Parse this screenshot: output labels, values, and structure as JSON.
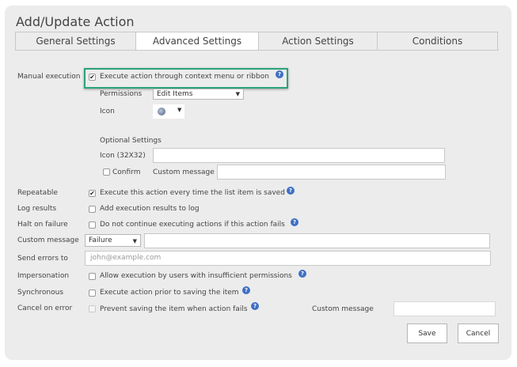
{
  "title": "Add/Update Action",
  "tabs": [
    "General Settings",
    "Advanced Settings",
    "Action Settings",
    "Conditions"
  ],
  "manual_execution": {
    "label": "Manual execution",
    "checkbox_label": "Execute action through context menu or ribbon",
    "permissions_label": "Permissions",
    "permissions_value": "Edit Items",
    "icon_label": "Icon",
    "optional_title": "Optional Settings",
    "icon32_label": "Icon (32X32)",
    "confirm_label": "Confirm",
    "custom_message_label": "Custom message"
  },
  "rows": {
    "repeatable": {
      "label": "Repeatable",
      "text": "Execute this action every time the list item is saved"
    },
    "log_results": {
      "label": "Log results",
      "text": "Add execution results to log"
    },
    "halt_on_failure": {
      "label": "Halt on failure",
      "text": "Do not continue executing actions if this action fails"
    },
    "custom_message": {
      "label": "Custom message",
      "select_value": "Failure"
    },
    "send_errors": {
      "label": "Send errors to",
      "placeholder": "john@example.com"
    },
    "impersonation": {
      "label": "Impersonation",
      "text": "Allow execution by users with insufficient permissions"
    },
    "synchronous": {
      "label": "Synchronous",
      "text": "Execute action prior to saving the item"
    },
    "cancel_on_error": {
      "label": "Cancel on error",
      "text": "Prevent saving the item when action fails",
      "custom_message_label": "Custom message"
    }
  },
  "buttons": {
    "save": "Save",
    "cancel": "Cancel"
  },
  "colors": {
    "highlight": "#2aa37a",
    "help": "#3f6fc4",
    "dialog_bg": "#ececec"
  },
  "icons": {
    "help": "question-circle-icon",
    "check": "checkmark-icon",
    "dropdown": "triangle-down-icon"
  }
}
